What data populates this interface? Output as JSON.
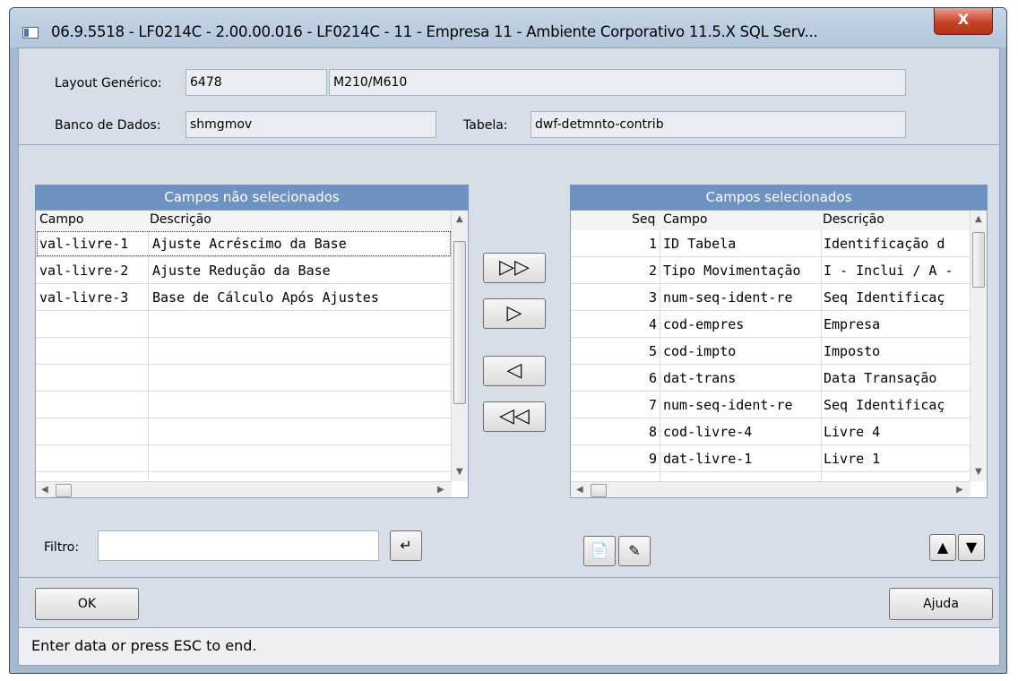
{
  "window": {
    "title": "06.9.5518 - LF0214C - 2.00.00.016 - LF0214C - 11 - Empresa 11 - Ambiente Corporativo 11.5.X SQL Serv...",
    "close_label": "X"
  },
  "header": {
    "layout_label": "Layout Genérico:",
    "layout_code": "6478",
    "layout_desc": "M210/M610",
    "db_label": "Banco de Dados:",
    "db_value": "shmgmov",
    "table_label": "Tabela:",
    "table_value": "dwf-detmnto-contrib"
  },
  "left_panel": {
    "title": "Campos não selecionados",
    "col_campo": "Campo",
    "col_desc": "Descrição",
    "rows": [
      {
        "campo": "val-livre-1",
        "desc": "Ajuste Acréscimo da Base"
      },
      {
        "campo": "val-livre-2",
        "desc": "Ajuste Redução da Base"
      },
      {
        "campo": "val-livre-3",
        "desc": "Base de Cálculo Após Ajustes"
      }
    ]
  },
  "right_panel": {
    "title": "Campos selecionados",
    "col_seq": "Seq",
    "col_campo": "Campo",
    "col_desc": "Descrição",
    "rows": [
      {
        "seq": "1",
        "campo": "ID Tabela",
        "desc": "Identificação d"
      },
      {
        "seq": "2",
        "campo": "Tipo Movimentação",
        "desc": "I - Inclui / A -"
      },
      {
        "seq": "3",
        "campo": "num-seq-ident-re",
        "desc": "Seq Identificaç"
      },
      {
        "seq": "4",
        "campo": "cod-empres",
        "desc": "Empresa"
      },
      {
        "seq": "5",
        "campo": "cod-impto",
        "desc": "Imposto"
      },
      {
        "seq": "6",
        "campo": "dat-trans",
        "desc": "Data Transação"
      },
      {
        "seq": "7",
        "campo": "num-seq-ident-re",
        "desc": "Seq Identificaç"
      },
      {
        "seq": "8",
        "campo": "cod-livre-4",
        "desc": "Livre 4"
      },
      {
        "seq": "9",
        "campo": "dat-livre-1",
        "desc": "Livre 1"
      }
    ]
  },
  "move_buttons": {
    "add_all": "▷▷",
    "add_one": "▷",
    "remove_one": "◁",
    "remove_all": "◁◁"
  },
  "filter": {
    "label": "Filtro:",
    "value": ""
  },
  "footer": {
    "ok_label": "OK",
    "help_label": "Ajuda",
    "status_text": "Enter data or press ESC to end."
  },
  "colors": {
    "panel_title_bg": "#6e92c1",
    "window_frame": "#a6b9cf",
    "client_bg": "#d7dee8"
  }
}
